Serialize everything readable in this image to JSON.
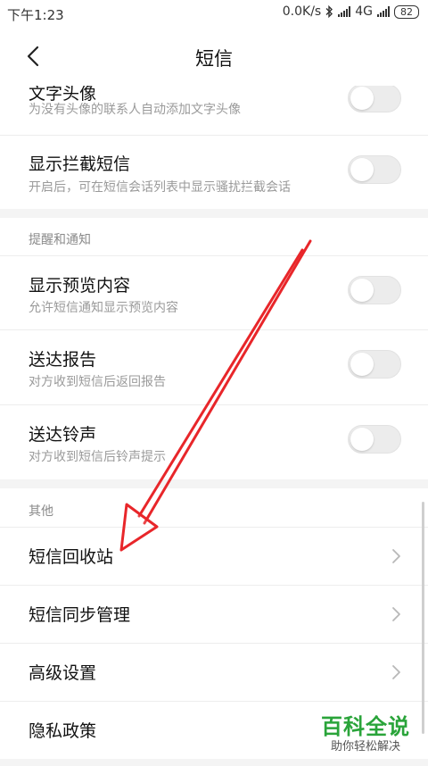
{
  "status_bar": {
    "time": "下午1:23",
    "speed": "0.0K/s",
    "network": "4G",
    "battery": "82"
  },
  "header": {
    "title": "短信"
  },
  "sections": {
    "display": {
      "items": [
        {
          "title": "文字头像",
          "subtitle": "为没有头像的联系人自动添加文字头像",
          "toggle_on": false
        },
        {
          "title": "显示拦截短信",
          "subtitle": "开启后，可在短信会话列表中显示骚扰拦截会话",
          "toggle_on": false
        }
      ]
    },
    "notifications": {
      "header": "提醒和通知",
      "items": [
        {
          "title": "显示预览内容",
          "subtitle": "允许短信通知显示预览内容",
          "toggle_on": false
        },
        {
          "title": "送达报告",
          "subtitle": "对方收到短信后返回报告",
          "toggle_on": false
        },
        {
          "title": "送达铃声",
          "subtitle": "对方收到短信后铃声提示",
          "toggle_on": false
        }
      ]
    },
    "other": {
      "header": "其他",
      "items": [
        {
          "title": "短信回收站"
        },
        {
          "title": "短信同步管理"
        },
        {
          "title": "高级设置"
        },
        {
          "title": "隐私政策"
        }
      ]
    }
  },
  "watermark": {
    "main": "百科全说",
    "sub": "助你轻松解决"
  },
  "colors": {
    "arrow": "#e8262a",
    "watermark": "#2aa43a",
    "toggle_off": "#ececec"
  }
}
